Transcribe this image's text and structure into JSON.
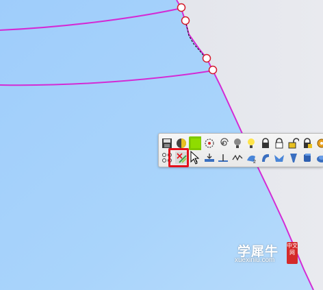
{
  "viewport": {
    "surface_color": "#a8d3fa",
    "curve_color": "#d42ad4",
    "background_color": "#e4e6ec"
  },
  "toolbar": {
    "row1": [
      "save-icon",
      "shade-sphere-icon",
      "color-swatch-icon",
      "select-lasso-icon",
      "spiral-icon",
      "bulb-icon",
      "bulb-on-icon",
      "lock-dark-icon",
      "lock-icon",
      "unlock-icon",
      "lock-color-icon",
      "gear-icon"
    ],
    "row2": [
      "curve-network-icon",
      "remove-selection-icon",
      "pointer-icon",
      "flatten-icon",
      "surface-normal-icon",
      "curve-zigzag-icon",
      "loft-2-icon",
      "revolve-icon",
      "sweep-icon",
      "extrude-icon",
      "solid-icon",
      "cap-icon"
    ],
    "highlight_color": "#e4111b"
  },
  "watermark": {
    "brand": "学犀牛",
    "url": "xuexiniu.com",
    "seal": "中文网"
  }
}
